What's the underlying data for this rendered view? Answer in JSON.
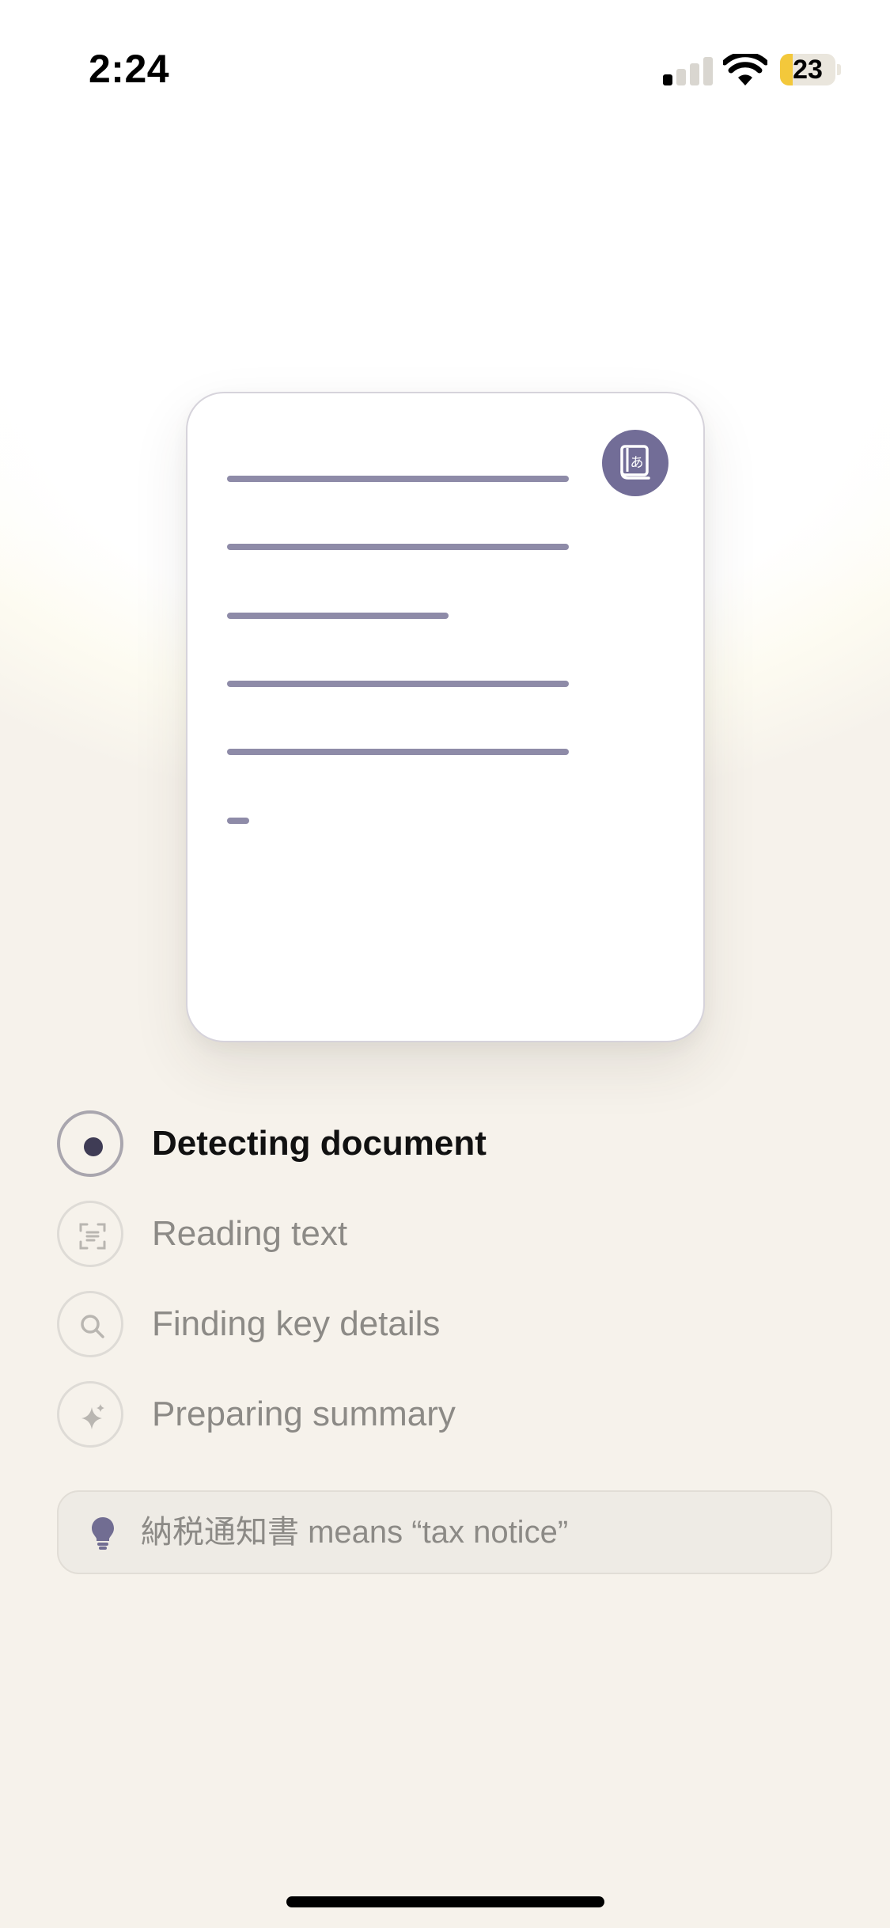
{
  "status_bar": {
    "time": "2:24",
    "battery_level": "23",
    "signal_bars_active": 1,
    "signal_bars_total": 4
  },
  "document_preview": {
    "badge_icon": "translate-book-icon",
    "badge_color": "#726d97",
    "line_color": "#8e8ba8"
  },
  "steps": [
    {
      "label": "Detecting document",
      "icon": "progress-dot-icon",
      "state": "active"
    },
    {
      "label": "Reading text",
      "icon": "text-scan-icon",
      "state": "pending"
    },
    {
      "label": "Finding key details",
      "icon": "search-icon",
      "state": "pending"
    },
    {
      "label": "Preparing summary",
      "icon": "sparkle-icon",
      "state": "pending"
    }
  ],
  "tip": {
    "icon": "lightbulb-icon",
    "text": "納税通知書 means “tax notice”"
  },
  "colors": {
    "background": "#f6f2eb",
    "accent": "#3f3c55",
    "battery_fill": "#f3c83b",
    "muted_text": "#8c8a86"
  }
}
